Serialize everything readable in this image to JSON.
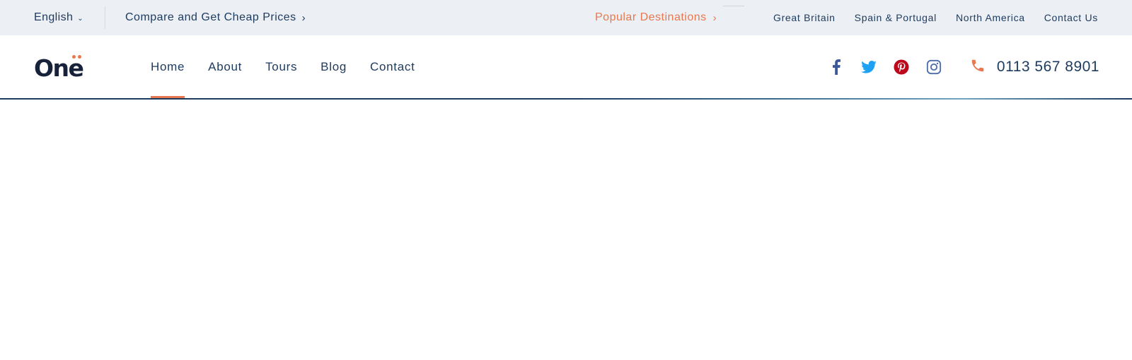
{
  "topbar": {
    "language": "English",
    "compare_link": "Compare and Get Cheap Prices",
    "popular_link": "Popular Destinations",
    "links": [
      "Great Britain",
      "Spain & Portugal",
      "North America",
      "Contact Us"
    ]
  },
  "header": {
    "logo": "One",
    "nav": [
      "Home",
      "About",
      "Tours",
      "Blog",
      "Contact"
    ],
    "active_nav": "Home",
    "social": [
      "facebook-icon",
      "twitter-icon",
      "pinterest-icon",
      "instagram-icon"
    ],
    "phone": "0113 567 8901"
  },
  "colors": {
    "accent": "#e8784f",
    "navy": "#1d3a5f",
    "topbar_bg": "#eceff3",
    "facebook": "#3b5998",
    "twitter": "#1da1f2",
    "pinterest": "#bd081c",
    "instagram": "#4c6ea8"
  }
}
